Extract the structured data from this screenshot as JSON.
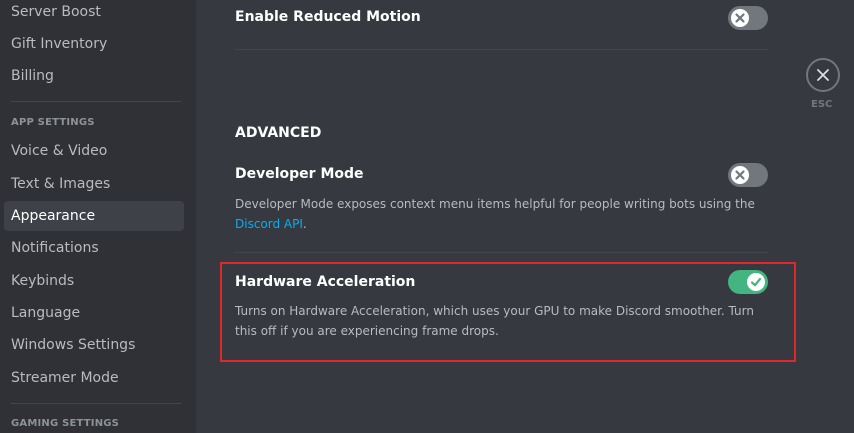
{
  "sidebar": {
    "items_top": [
      {
        "label": "Server Boost"
      },
      {
        "label": "Gift Inventory"
      },
      {
        "label": "Billing"
      }
    ],
    "app_settings_header": "APP SETTINGS",
    "app_items": [
      {
        "label": "Voice & Video"
      },
      {
        "label": "Text & Images"
      },
      {
        "label": "Appearance",
        "active": true
      },
      {
        "label": "Notifications"
      },
      {
        "label": "Keybinds"
      },
      {
        "label": "Language"
      },
      {
        "label": "Windows Settings"
      },
      {
        "label": "Streamer Mode"
      }
    ],
    "gaming_settings_header": "GAMING SETTINGS"
  },
  "main": {
    "reduced_motion": {
      "title": "Enable Reduced Motion",
      "enabled": false
    },
    "advanced_heading": "ADVANCED",
    "developer_mode": {
      "title": "Developer Mode",
      "enabled": false,
      "description": "Developer Mode exposes context menu items helpful for people writing bots using the ",
      "link_text": "Discord API",
      "description_end": "."
    },
    "hardware_acceleration": {
      "title": "Hardware Acceleration",
      "enabled": true,
      "description": "Turns on Hardware Acceleration, which uses your GPU to make Discord smoother. Turn this off if you are experiencing frame drops."
    }
  },
  "close": {
    "label": "ESC"
  },
  "colors": {
    "background": "#36393f",
    "sidebar": "#2f3136",
    "toggle_on": "#43b581",
    "toggle_off": "#72767d",
    "highlight": "#e0282b",
    "link": "#00b0f4"
  }
}
